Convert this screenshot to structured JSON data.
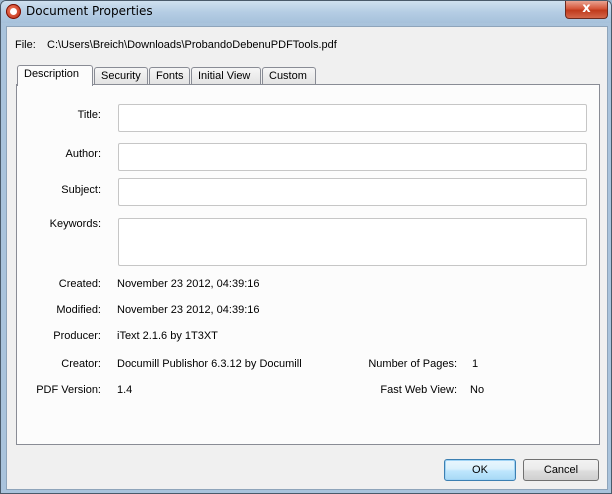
{
  "window": {
    "title": "Document Properties",
    "close_glyph": "x"
  },
  "file": {
    "label": "File:",
    "path": "C:\\Users\\Breich\\Downloads\\ProbandoDebenuPDFTools.pdf"
  },
  "tabs": [
    {
      "label": "Description",
      "active": true
    },
    {
      "label": "Security",
      "active": false
    },
    {
      "label": "Fonts",
      "active": false
    },
    {
      "label": "Initial View",
      "active": false
    },
    {
      "label": "Custom",
      "active": false
    }
  ],
  "description": {
    "title_label": "Title:",
    "title_value": "",
    "author_label": "Author:",
    "author_value": "",
    "subject_label": "Subject:",
    "subject_value": "",
    "keywords_label": "Keywords:",
    "keywords_value": "",
    "created_label": "Created:",
    "created_value": "November 23 2012, 04:39:16",
    "modified_label": "Modified:",
    "modified_value": "November 23 2012, 04:39:16",
    "producer_label": "Producer:",
    "producer_value": "iText 2.1.6 by 1T3XT",
    "creator_label": "Creator:",
    "creator_value": "Documill Publishor 6.3.12 by Documill",
    "pages_label": "Number of Pages:",
    "pages_value": "1",
    "pdf_version_label": "PDF Version:",
    "pdf_version_value": "1.4",
    "fast_web_label": "Fast Web View:",
    "fast_web_value": "No"
  },
  "buttons": {
    "ok_label": "OK",
    "cancel_label": "Cancel"
  },
  "icons": {
    "app": "pdf-app-icon",
    "close": "close-icon"
  }
}
